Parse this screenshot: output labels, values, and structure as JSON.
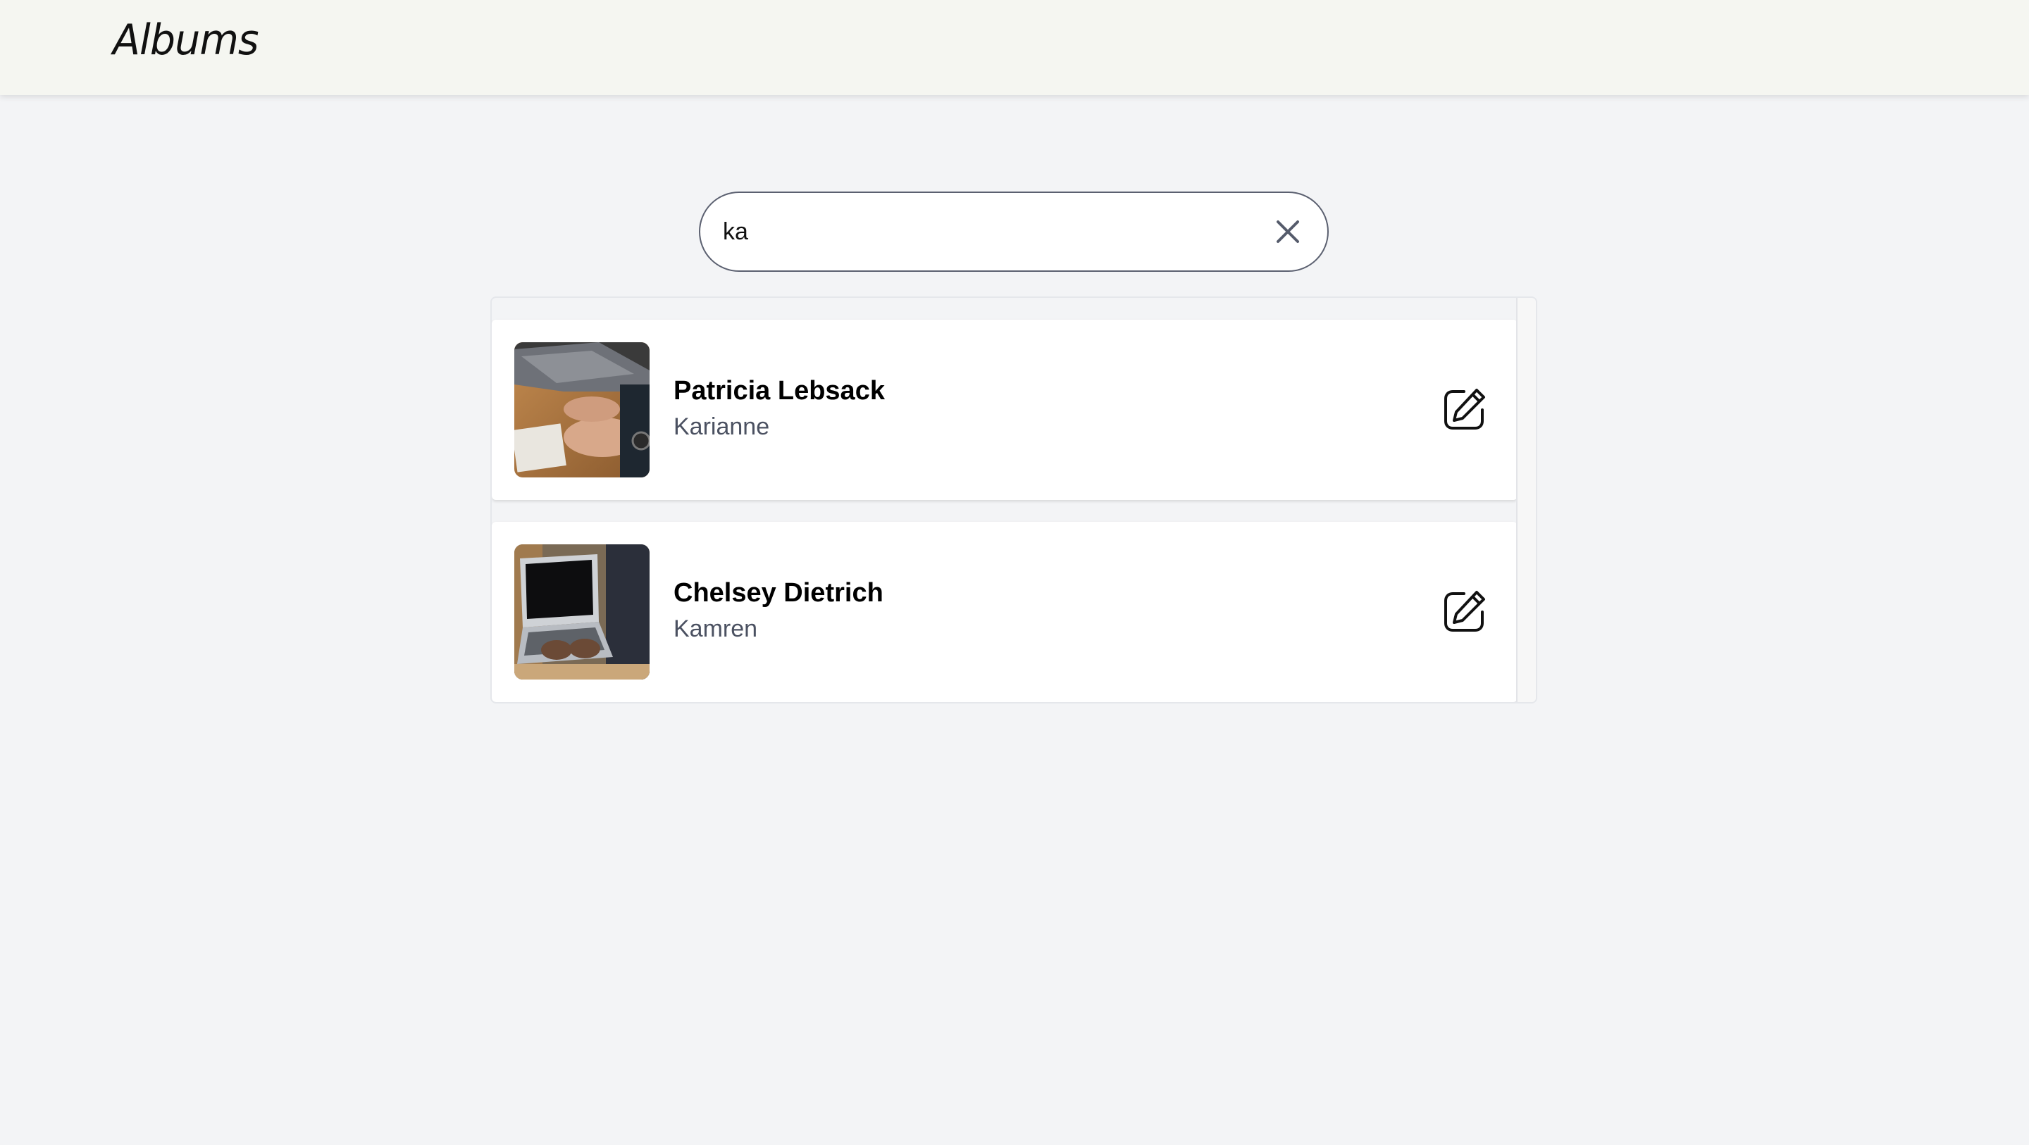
{
  "header": {
    "title": "Albums"
  },
  "search": {
    "value": "ka",
    "clear_icon": "close-icon"
  },
  "results": [
    {
      "title": "Patricia Lebsack",
      "subtitle": "Karianne",
      "thumbnail": "photo of hands writing in a notebook next to a laptop",
      "action_icon": "edit-icon"
    },
    {
      "title": "Chelsey Dietrich",
      "subtitle": "Kamren",
      "thumbnail": "photo of person typing on a laptop",
      "action_icon": "edit-icon"
    }
  ],
  "colors": {
    "header_bg": "#f5f6f1",
    "page_bg": "#f3f4f6",
    "card_bg": "#ffffff",
    "subtitle": "#4b5161",
    "search_border": "#5b6070"
  }
}
